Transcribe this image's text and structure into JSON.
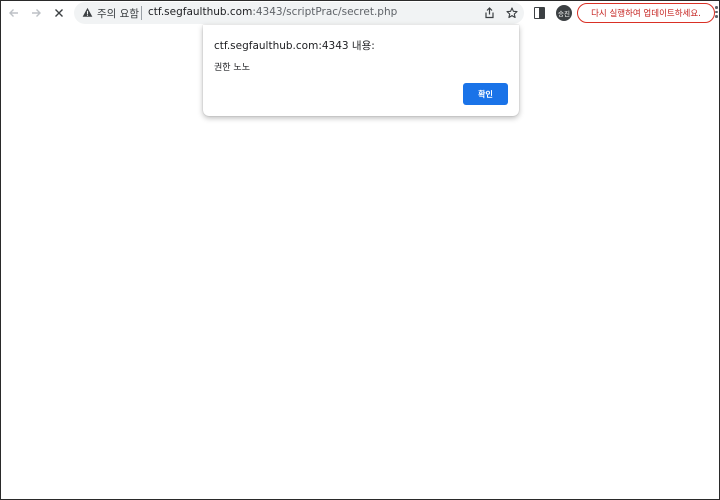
{
  "toolbar": {
    "back_icon": "arrow-left-icon",
    "forward_icon": "arrow-right-icon",
    "stop_icon": "close-icon",
    "security_warning": "주의 요함",
    "url_host": "ctf.segfaulthub.com",
    "url_rest": ":4343/scriptPrac/secret.php",
    "share_icon": "share-icon",
    "bookmark_icon": "star-icon",
    "side_panel_icon": "side-panel-icon",
    "profile_label": "승진",
    "relaunch_label": "다시 실행하여 업데이트하세요."
  },
  "dialog": {
    "title": "ctf.segfaulthub.com:4343 내용:",
    "message": "권한 노노",
    "ok_label": "확인"
  },
  "colors": {
    "accent": "#1a73e8",
    "warning": "#d93025",
    "omnibox_bg": "#f1f3f4"
  }
}
